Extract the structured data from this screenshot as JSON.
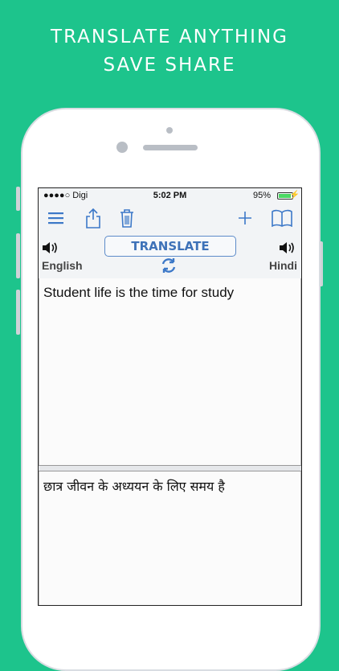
{
  "headline": {
    "line1": "TRANSLATE ANYTHING",
    "line2": "SAVE SHARE"
  },
  "status_bar": {
    "carrier": "●●●●○ Digi",
    "time": "5:02 PM",
    "battery_pct": "95%",
    "battery_level": 0.95
  },
  "toolbar": {
    "icons": [
      "menu-icon",
      "share-icon",
      "trash-icon",
      "add-icon",
      "book-icon"
    ]
  },
  "language_bar": {
    "source_lang": "English",
    "target_lang": "Hindi",
    "translate_label": "TRANSLATE"
  },
  "input": {
    "text": "Student life is the time for study"
  },
  "output": {
    "text": "छात्र जीवन के अध्ययन के लिए समय है"
  },
  "colors": {
    "background": "#1dc48c",
    "accent": "#3c78c8",
    "button_text": "#3e72b8"
  }
}
